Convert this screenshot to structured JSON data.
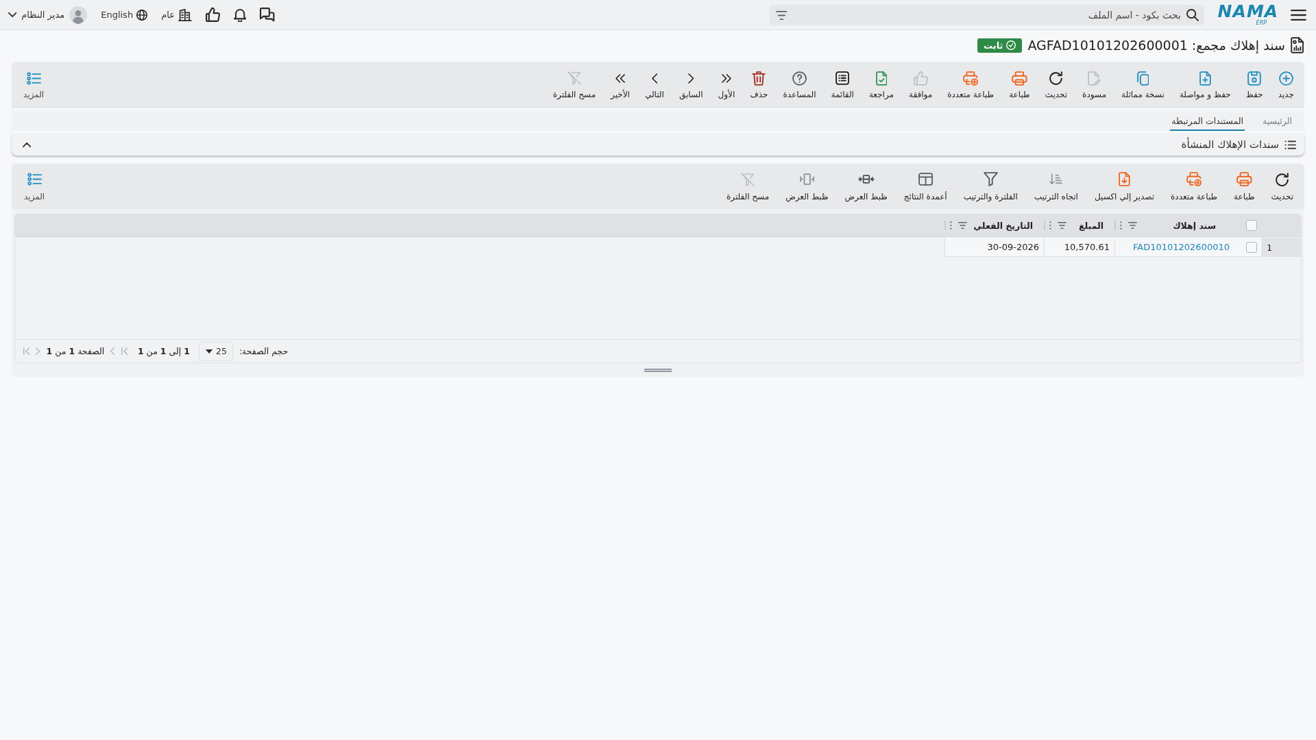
{
  "top_bar": {
    "logo": {
      "name": "NAMA",
      "suffix": "ERP"
    },
    "search": {
      "placeholder": "بحث بكود - اسم الملف"
    },
    "company": "عام",
    "language": "English",
    "user": "مدير النظام"
  },
  "header": {
    "title": "سند إهلاك مجمع: AGFAD10101202600001",
    "status": "ثابت"
  },
  "toolbar": {
    "items": [
      {
        "kind": "new",
        "label": "جديد",
        "disabled": false
      },
      {
        "kind": "save",
        "label": "حفظ",
        "disabled": false
      },
      {
        "kind": "save-continue",
        "label": "حفظ و مواصلة",
        "disabled": false
      },
      {
        "kind": "duplicate",
        "label": "نسخة مماثلة",
        "disabled": false
      },
      {
        "kind": "draft",
        "label": "مسودة",
        "disabled": true
      },
      {
        "kind": "refresh",
        "label": "تحديث",
        "disabled": false
      },
      {
        "kind": "print",
        "label": "طباعة",
        "disabled": false
      },
      {
        "kind": "multi-print",
        "label": "طباعة متعددة",
        "disabled": false
      },
      {
        "kind": "approve",
        "label": "موافقة",
        "disabled": true
      },
      {
        "kind": "review",
        "label": "مراجعة",
        "disabled": false
      },
      {
        "kind": "list",
        "label": "القائمة",
        "disabled": false
      },
      {
        "kind": "help",
        "label": "المساعدة",
        "disabled": false
      },
      {
        "kind": "delete",
        "label": "حذف",
        "disabled": false
      },
      {
        "kind": "first",
        "label": "الأول",
        "disabled": false
      },
      {
        "kind": "previous",
        "label": "السابق",
        "disabled": false
      },
      {
        "kind": "next",
        "label": "التالي",
        "disabled": false
      },
      {
        "kind": "last",
        "label": "الأخير",
        "disabled": false
      },
      {
        "kind": "clear-filter",
        "label": "مسح الفلترة",
        "disabled": true
      }
    ],
    "more": "المزيد"
  },
  "tabs": [
    {
      "label": "الرئيسية",
      "selected": false
    },
    {
      "label": "المستندات المرتبطة",
      "selected": true
    }
  ],
  "section": {
    "title": "سندات الإهلاك المنشأة",
    "expanded": true,
    "toolbar": {
      "items": [
        {
          "kind": "refresh",
          "label": "تحديث",
          "disabled": false
        },
        {
          "kind": "print",
          "label": "طباعة",
          "disabled": false
        },
        {
          "kind": "multi-print",
          "label": "طباعة متعددة",
          "disabled": false
        },
        {
          "kind": "export-excel",
          "label": "تصدير إلي اكسيل",
          "disabled": false
        },
        {
          "kind": "sort-direction",
          "label": "اتجاه الترتيب",
          "disabled": false
        },
        {
          "kind": "filter",
          "label": "الفلترة والترتيب",
          "disabled": false
        },
        {
          "kind": "columns",
          "label": "أعمدة النتائج",
          "disabled": false
        },
        {
          "kind": "fit-columns",
          "label": "ظبط العرض",
          "disabled": false
        },
        {
          "kind": "fit-width",
          "label": "ظبط العرض",
          "disabled": false
        },
        {
          "kind": "clear-filter",
          "label": "مسح الفلترة",
          "disabled": true
        }
      ],
      "more": "المزيد"
    },
    "table": {
      "all_selected": false,
      "columns": [
        "سند إهلاك",
        "المبلغ",
        "التاريخ الفعلي"
      ],
      "rows": [
        {
          "number": "1",
          "selected": false,
          "cells": [
            "FAD10101202600010",
            "10,570.61",
            "30-09-2026"
          ]
        }
      ]
    },
    "pagination": {
      "page_size_label": "حجم الصفحة:",
      "page_size": "25",
      "range": "**1** إلى **1** من **1**",
      "page": "الصفحة **1** من **1**"
    }
  }
}
